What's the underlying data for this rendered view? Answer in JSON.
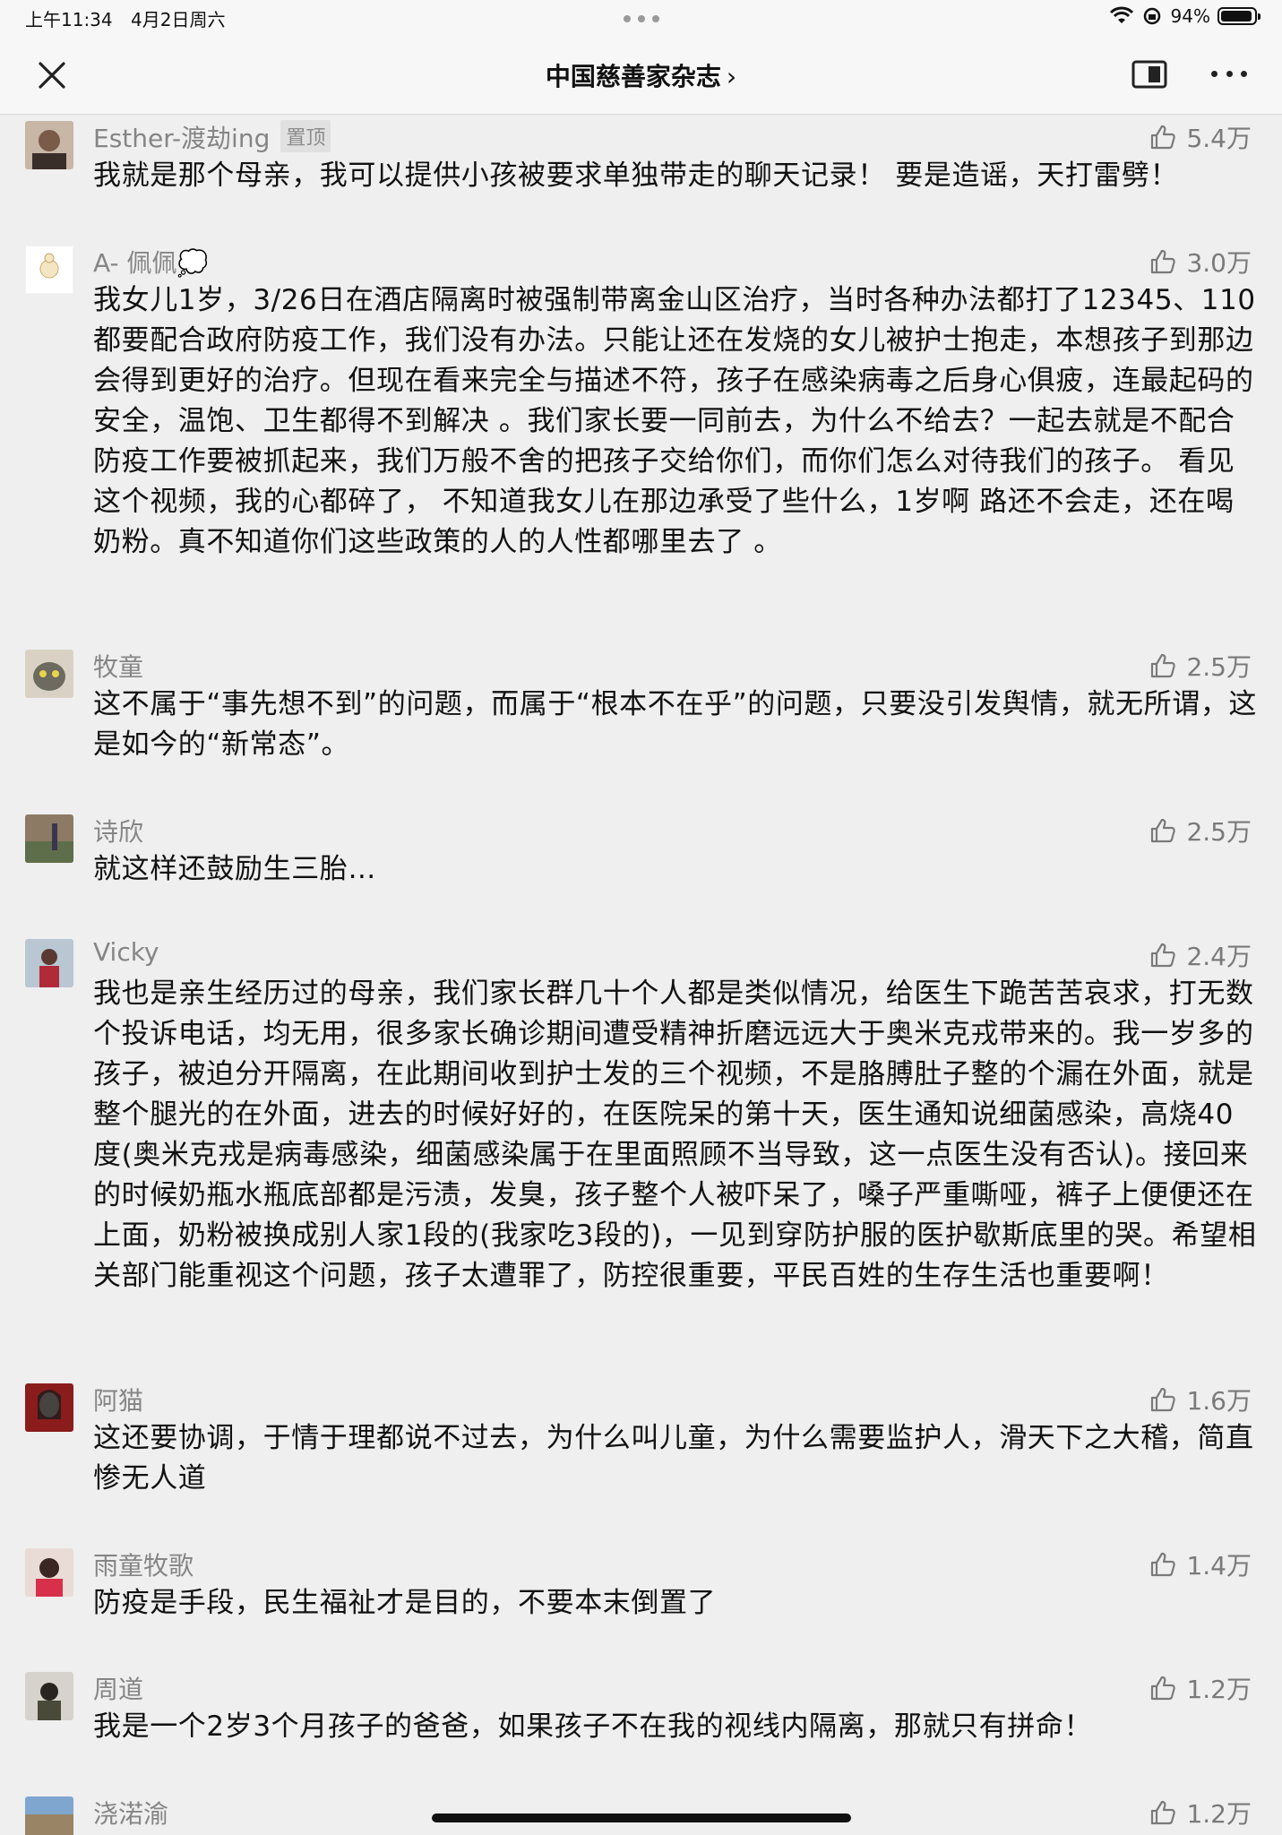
{
  "status_bar": {
    "time": "上午11:34",
    "date": "4月2日周六",
    "battery": "94%",
    "battery_level": 0.94
  },
  "nav": {
    "title": "中国慈善家杂志",
    "title_chevron": "›"
  },
  "comments": [
    {
      "name": "Esther-渡劫ing",
      "pinned": "置顶",
      "likes": "5.4万",
      "text": "我就是那个母亲，我可以提供小孩被要求单独带走的聊天记录！ 要是造谣，天打雷劈！"
    },
    {
      "name": "A- 佩佩💭",
      "likes": "3.0万",
      "text": "我女儿1岁，3/26日在酒店隔离时被强制带离金山区治疗，当时各种办法都打了12345、110 都要配合政府防疫工作，我们没有办法。只能让还在发烧的女儿被护士抱走，本想孩子到那边会得到更好的治疗。但现在看来完全与描述不符，孩子在感染病毒之后身心俱疲，连最起码的安全，温饱、卫生都得不到解决 。我们家长要一同前去，为什么不给去？一起去就是不配合防疫工作要被抓起来，我们万般不舍的把孩子交给你们，而你们怎么对待我们的孩子。 看见这个视频，我的心都碎了， 不知道我女儿在那边承受了些什么，1岁啊 路还不会走，还在喝奶粉。真不知道你们这些政策的人的人性都哪里去了 。"
    },
    {
      "name": "牧童",
      "likes": "2.5万",
      "text": "这不属于“事先想不到”的问题，而属于“根本不在乎”的问题，只要没引发舆情，就无所谓，这是如今的“新常态”。"
    },
    {
      "name": "诗欣",
      "likes": "2.5万",
      "text": "就这样还鼓励生三胎…"
    },
    {
      "name": "Vicky",
      "likes": "2.4万",
      "text": "我也是亲生经历过的母亲，我们家长群几十个人都是类似情况，给医生下跪苦苦哀求，打无数个投诉电话，均无用，很多家长确诊期间遭受精神折磨远远大于奥米克戎带来的。我一岁多的孩子，被迫分开隔离，在此期间收到护士发的三个视频，不是胳膊肚子整的个漏在外面，就是整个腿光的在外面，进去的时候好好的，在医院呆的第十天，医生通知说细菌感染，高烧40度(奥米克戎是病毒感染，细菌感染属于在里面照顾不当导致，这一点医生没有否认)。接回来的时候奶瓶水瓶底部都是污渍，发臭，孩子整个人被吓呆了，嗓子严重嘶哑，裤子上便便还在上面，奶粉被换成别人家1段的(我家吃3段的)，一见到穿防护服的医护歇斯底里的哭。希望相关部门能重视这个问题，孩子太遭罪了，防控很重要，平民百姓的生存生活也重要啊！"
    },
    {
      "name": "阿猫",
      "likes": "1.6万",
      "text": "这还要协调，于情于理都说不过去，为什么叫儿童，为什么需要监护人，滑天下之大稽，简直惨无人道"
    },
    {
      "name": "雨童牧歌",
      "likes": "1.4万",
      "text": "防疫是手段，民生福祉才是目的，不要本末倒置了"
    },
    {
      "name": "周道",
      "likes": "1.2万",
      "text": "我是一个2岁3个月孩子的爸爸，如果孩子不在我的视线内隔离，那就只有拼命！"
    },
    {
      "name": "浇渃渝",
      "likes": "1.2万",
      "text": ""
    }
  ],
  "colors": {
    "background": "#efefef",
    "name_gray": "#858585",
    "like_gray": "#7a7a7a"
  }
}
